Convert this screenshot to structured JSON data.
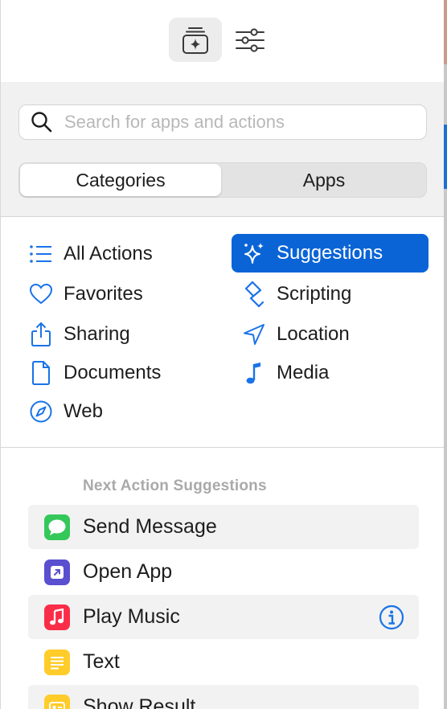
{
  "toolbar": {
    "actions_library_icon": "sparkle-library-icon",
    "settings_icon": "sliders-icon"
  },
  "search": {
    "placeholder": "Search for apps and actions",
    "value": ""
  },
  "segmented": {
    "left_label": "Categories",
    "right_label": "Apps",
    "selected": "Categories"
  },
  "categories": {
    "col1": [
      {
        "label": "All Actions",
        "icon": "list-icon"
      },
      {
        "label": "Favorites",
        "icon": "heart-icon"
      },
      {
        "label": "Sharing",
        "icon": "share-icon"
      },
      {
        "label": "Documents",
        "icon": "document-icon"
      },
      {
        "label": "Web",
        "icon": "compass-icon"
      }
    ],
    "col2": [
      {
        "label": "Suggestions",
        "icon": "sparkles-icon",
        "selected": true
      },
      {
        "label": "Scripting",
        "icon": "scripting-icon"
      },
      {
        "label": "Location",
        "icon": "location-arrow-icon"
      },
      {
        "label": "Media",
        "icon": "music-note-icon"
      }
    ]
  },
  "suggestions": {
    "heading": "Next Action Suggestions",
    "items": [
      {
        "label": "Send Message",
        "icon": "messages-icon",
        "color": "#34c759"
      },
      {
        "label": "Open App",
        "icon": "open-app-icon",
        "color": "#5a4fcf"
      },
      {
        "label": "Play Music",
        "icon": "music-app-icon",
        "color": "#fa2d48"
      },
      {
        "label": "Text",
        "icon": "text-icon",
        "color": "#ffcc2a"
      },
      {
        "label": "Show Result",
        "icon": "show-result-icon",
        "color": "#ffcc2a"
      }
    ]
  },
  "colors": {
    "accent": "#0a64d6",
    "icon_blue": "#1a73e8"
  }
}
